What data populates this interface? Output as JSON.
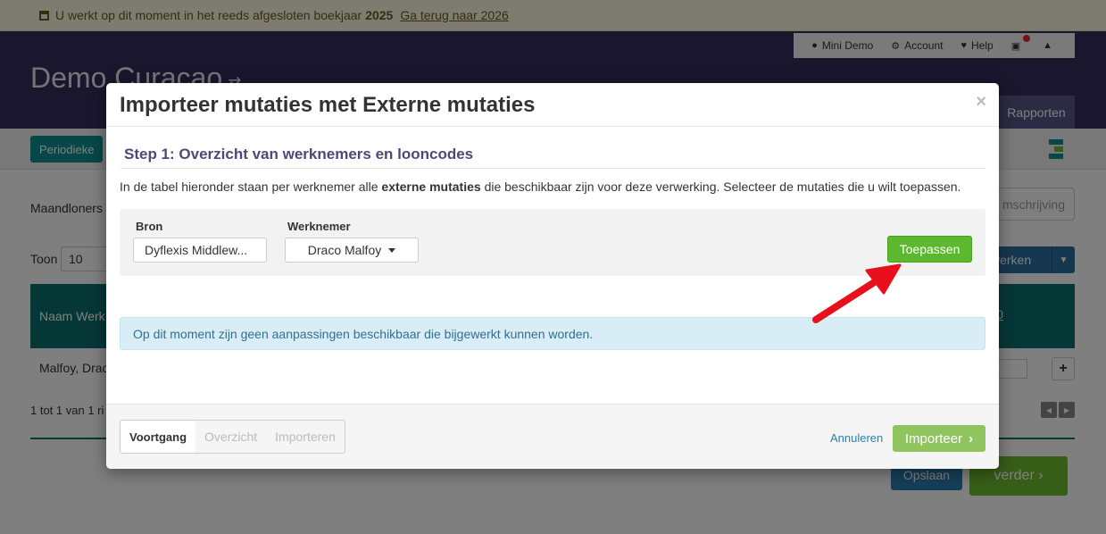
{
  "notice": {
    "text_pre": "U werkt op dit moment in het reeds afgesloten boekjaar",
    "year": "2025",
    "link": "Ga terug naar 2026"
  },
  "header": {
    "company": "Demo Curacao",
    "nav": {
      "user": "Mini Demo",
      "account": "Account",
      "help": "Help"
    },
    "rapporten": "Rapporten"
  },
  "subbar": {
    "periodieke": "Periodieke"
  },
  "background": {
    "maandloners": "Maandloners",
    "omschrijving": "mschrijving",
    "toon_label": "Toon",
    "toon_value": "10",
    "bewerken": "werken",
    "table_head": "Naam Werk",
    "table_head_right": "0",
    "row_name": "Malfoy, Draco",
    "pager_text": "1 tot 1 van 1 ri",
    "opslaan": "Opslaan",
    "verder": "verder"
  },
  "modal": {
    "title": "Importeer mutaties met Externe mutaties",
    "close": "×",
    "step_title": "Step 1: Overzicht van werknemers en looncodes",
    "desc_pre": "In de tabel hieronder staan per werknemer alle",
    "desc_bold": "externe mutaties",
    "desc_post": "die beschikbaar zijn voor deze verwerking. Selecteer de mutaties die u wilt toepassen.",
    "filters": {
      "bron_label": "Bron",
      "bron_value": "Dyflexis Middlew...",
      "werknemer_label": "Werknemer",
      "werknemer_value": "Draco Malfoy",
      "apply": "Toepassen"
    },
    "info": "Op dit moment zijn geen aanpassingen beschikbaar die bijgewerkt kunnen worden.",
    "footer": {
      "progress": [
        "Voortgang",
        "Overzicht",
        "Importeren"
      ],
      "cancel": "Annuleren",
      "import": "Importeer"
    }
  },
  "colors": {
    "header_bg": "#332d5c",
    "teal": "#0c6e6e",
    "apply_green": "#5cb82e",
    "import_green": "#8fc45f",
    "arrow_red": "#e8101c",
    "info_bg": "#d9edf7"
  }
}
